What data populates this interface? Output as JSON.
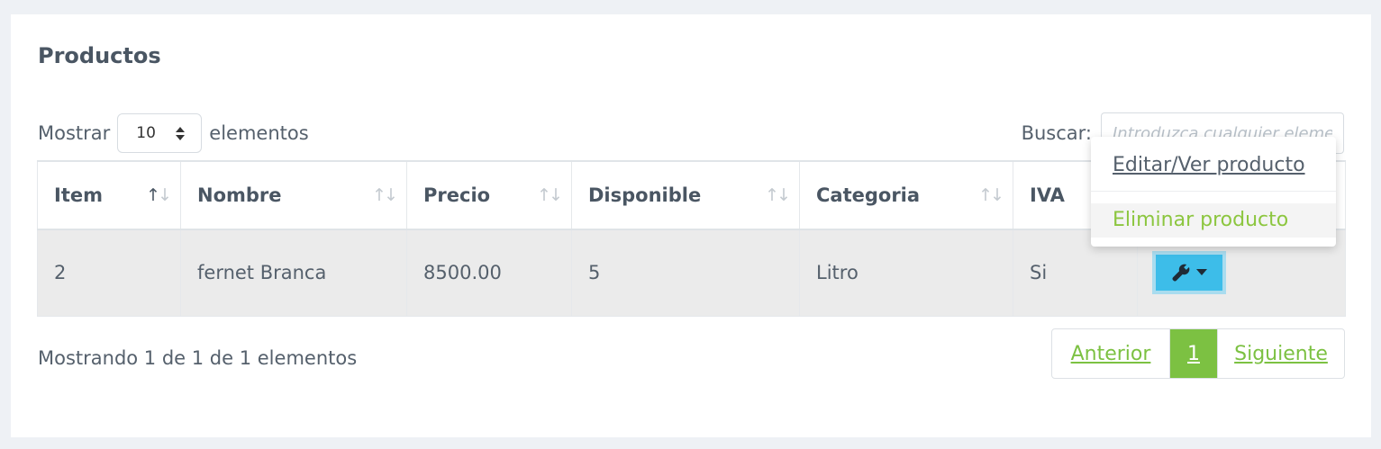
{
  "panel": {
    "title": "Productos"
  },
  "length_menu": {
    "prefix": "Mostrar",
    "value": "10",
    "suffix": "elementos"
  },
  "search": {
    "label": "Buscar:",
    "placeholder": "Introduzca cualquier elemento",
    "value": ""
  },
  "table": {
    "columns": [
      {
        "label": "Item",
        "sort": "asc"
      },
      {
        "label": "Nombre",
        "sort": "none"
      },
      {
        "label": "Precio",
        "sort": "none"
      },
      {
        "label": "Disponible",
        "sort": "none"
      },
      {
        "label": "Categoria",
        "sort": "none"
      },
      {
        "label": "IVA",
        "sort": "none"
      },
      {
        "label": "",
        "sort": "none"
      }
    ],
    "rows": [
      {
        "item": "2",
        "nombre": "fernet Branca",
        "precio": "8500.00",
        "disponible": "5",
        "categoria": "Litro",
        "iva": "Si"
      }
    ]
  },
  "actions_menu": {
    "button_icon": "wrench-icon",
    "items": [
      "Editar/Ver producto",
      "Eliminar producto"
    ]
  },
  "footer": {
    "info": "Mostrando 1 de 1 de 1 elementos",
    "pagination": {
      "previous": "Anterior",
      "current": "1",
      "next": "Siguiente"
    }
  },
  "colors": {
    "accent_green": "#7cc142",
    "button_blue": "#3dbde9",
    "row_highlight": "#ebebeb"
  }
}
